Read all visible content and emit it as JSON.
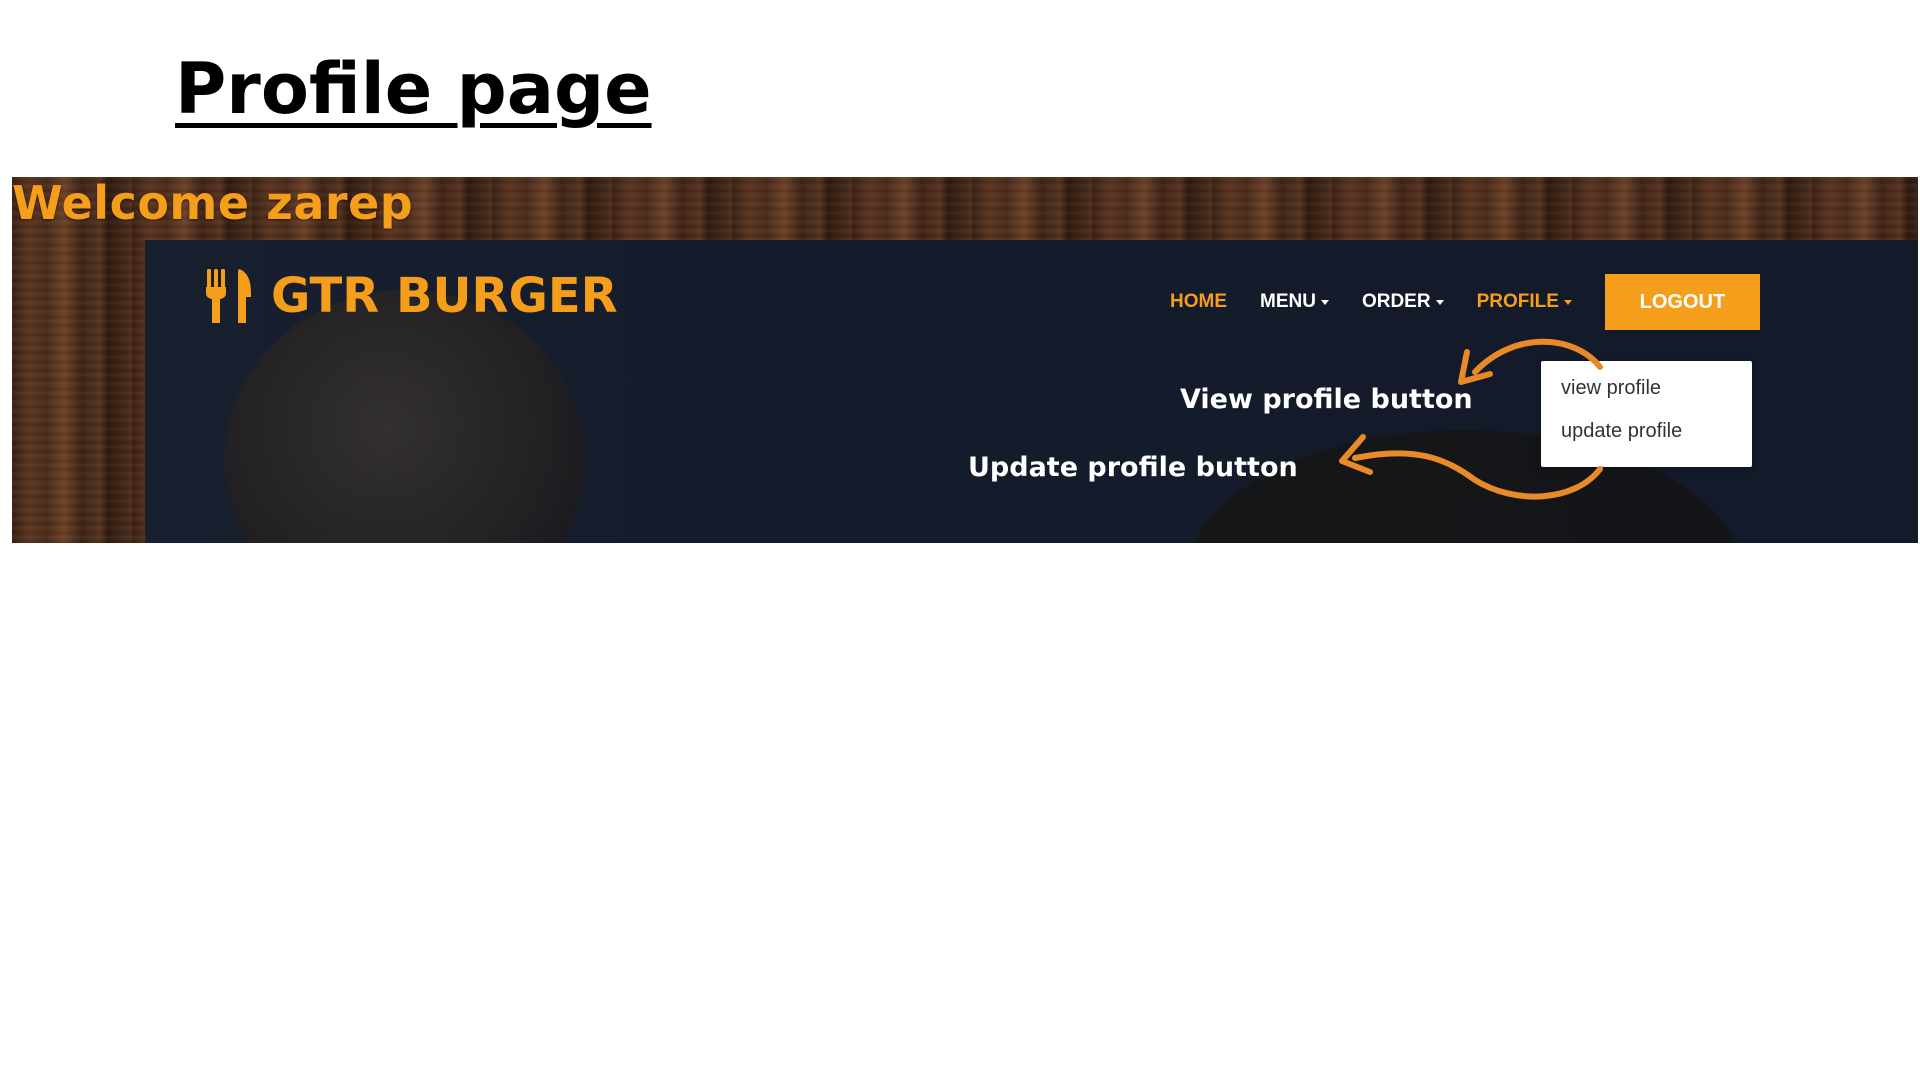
{
  "page": {
    "title": "Profile page"
  },
  "banner": {
    "welcome_text": "Welcome zarep"
  },
  "brand": {
    "name": "GTR BURGER",
    "icon": "fork-knife-icon",
    "color": "#f59e1b"
  },
  "nav": {
    "items": [
      {
        "label": "HOME",
        "active": true,
        "has_dropdown": false
      },
      {
        "label": "MENU",
        "active": false,
        "has_dropdown": true
      },
      {
        "label": "ORDER",
        "active": false,
        "has_dropdown": true
      },
      {
        "label": "PROFILE",
        "active": true,
        "has_dropdown": true
      }
    ],
    "logout_label": "LOGOUT"
  },
  "profile_dropdown": {
    "items": [
      {
        "label": "view profile"
      },
      {
        "label": "update profile"
      }
    ]
  },
  "annotations": {
    "view_label": "View profile button",
    "update_label": "Update profile button",
    "arrow_color": "#e8892a"
  },
  "colors": {
    "accent": "#f59e1b",
    "navbar_bg": "#141b2b",
    "nav_text": "#ffffff"
  }
}
